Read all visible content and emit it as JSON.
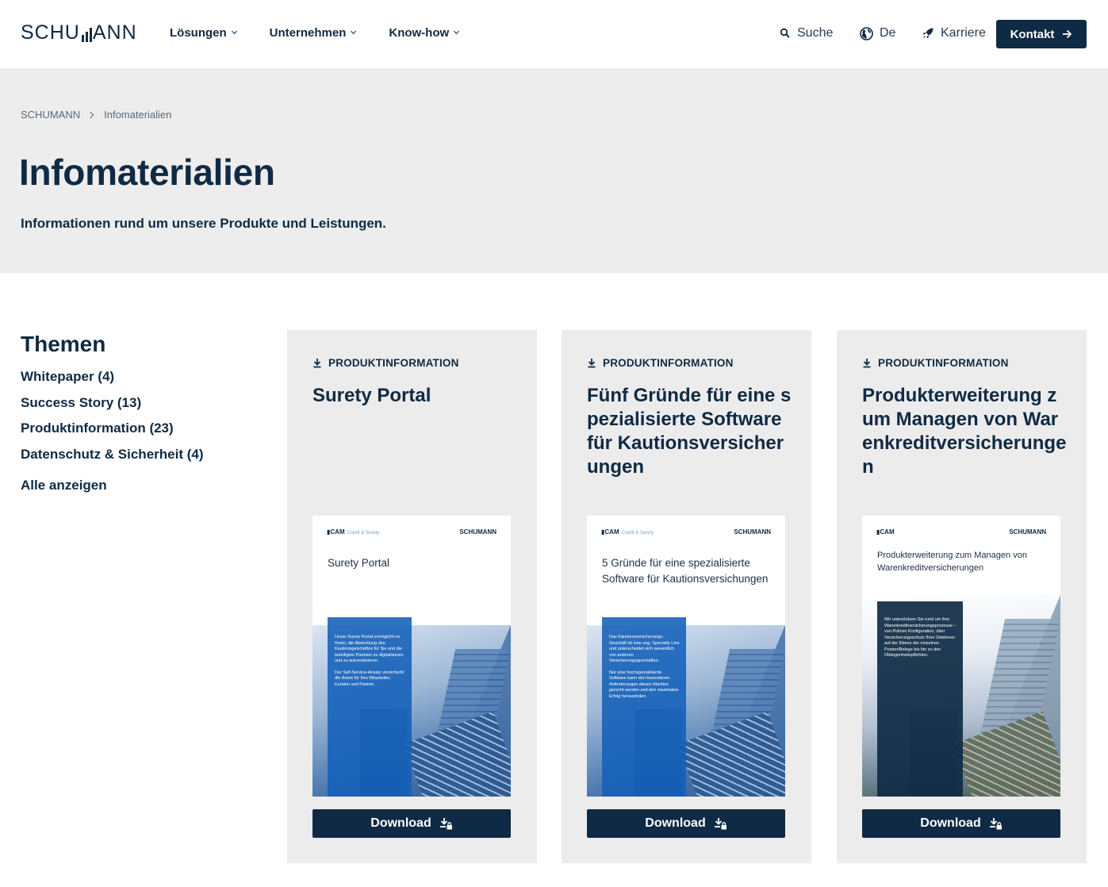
{
  "header": {
    "logo_text_left": "SCHU",
    "logo_text_right": "ANN",
    "nav": [
      {
        "label": "Lösungen"
      },
      {
        "label": "Unternehmen"
      },
      {
        "label": "Know-how"
      }
    ],
    "search_label": "Suche",
    "language_label": "De",
    "career_label": "Karriere",
    "contact_label": "Kontakt"
  },
  "breadcrumb": {
    "home": "SCHUMANN",
    "current": "Infomaterialien"
  },
  "hero": {
    "title": "Infomaterialien",
    "subtitle": "Informationen rund um unsere Produkte und Leistungen."
  },
  "sidebar": {
    "title": "Themen",
    "items": [
      {
        "label": "Whitepaper (4)"
      },
      {
        "label": "Success Story (13)"
      },
      {
        "label": "Produktinformation (23)"
      },
      {
        "label": "Datenschutz & Sicherheit (4)"
      }
    ],
    "show_all": "Alle anzeigen"
  },
  "cards": [
    {
      "category": "PRODUKTINFORMATION",
      "title": "Surety Portal",
      "download": "Download",
      "thumb": {
        "cam": "CAM",
        "cam_sub": "Credit & Surety",
        "brand": "SCHUMANN",
        "title": "Surety Portal",
        "panel_p1": "Unser Surety Portal ermöglicht es Ihnen, die Abwicklung des Kautionsgeschäftes für Sie und die beteiligten Parteien zu digitalisieren und zu automatisieren.",
        "panel_p2": "Der Self-Service-Ansatz vereinfacht die Arbeit für Ihre Mitarbeiter, Kunden und Partner."
      }
    },
    {
      "category": "PRODUKTINFORMATION",
      "title": "Fünf Gründe für eine spezialisierte Software für Kautionsversicherungen",
      "download": "Download",
      "thumb": {
        "cam": "CAM",
        "cam_sub": "Credit & Surety",
        "brand": "SCHUMANN",
        "title": "5 Gründe für eine spezialisierte Software für Kautionsversichungen",
        "panel_p1": "Das Kautionsversicherungs-Geschäft ist eine sog. Specialty Line und unterscheidet sich wesentlich von anderen Versicherungsgeschäften.",
        "panel_p2": "Nur eine hochspezialisierte Software kann den besonderen Anforderungen dieses Marktes gerecht werden und den maximalen Erfolg herausholen."
      }
    },
    {
      "category": "PRODUKTINFORMATION",
      "title": "Produkterweiterung zum Managen von Warenkreditversicherungen",
      "download": "Download",
      "thumb": {
        "cam": "CAM",
        "brand": "SCHUMANN",
        "title": "Produkterweiterung zum Managen von Warenkreditversicherungen",
        "panel_p1": "Wir unterstützen Sie rund um Ihre Warenkreditversicherungsprozesse – von Policen Konfiguration, über Versicherungsschutz Ihrer Debitoren auf der Ebene der einzelnen Posten/Belege bis hin zu den Obliegenheitspflichten."
      }
    }
  ]
}
